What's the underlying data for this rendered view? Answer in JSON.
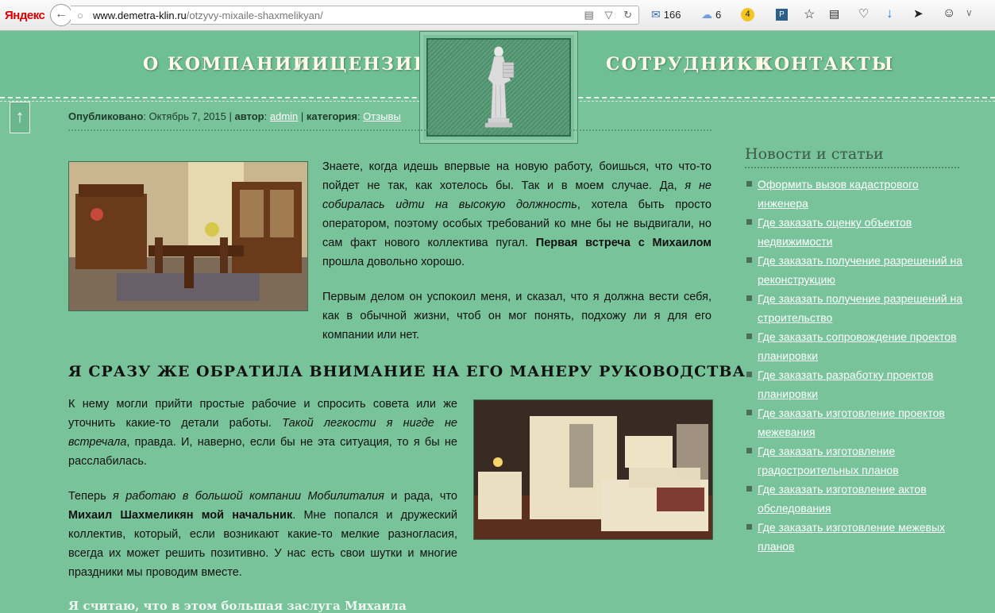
{
  "browser": {
    "logo": "Яндекс",
    "url_domain": "www.demetra-klin.ru",
    "url_path": "/otzyvy-mixaile-shaxmelikyan/",
    "mail_count": "166",
    "weather_count": "6",
    "badge_count": "4"
  },
  "nav": {
    "items": [
      "О КОМПАНИИ",
      "ЛИЦЕНЗИИ",
      "СОТРУДНИКИ",
      "КОНТАКТЫ"
    ]
  },
  "meta": {
    "published_label": "Опубликовано",
    "published_date": ": Октябрь 7, 2015 | ",
    "author_label": "автор",
    "author": "admin",
    "category_label": "категория",
    "category": "Отзывы"
  },
  "article": {
    "p1_a": "Знаете, когда идешь впервые на новую работу, боишься, что что-то пойдет не так, как хотелось бы. Так и в моем случае. Да, ",
    "p1_i": "я не собиралась идти на высокую должность",
    "p1_b": ", хотела быть просто оператором, поэтому особых требований ко мне бы не выдвигали, но сам факт нового коллектива пугал. ",
    "p1_bold": "Первая встреча с Михаилом",
    "p1_c": " прошла довольно хорошо.",
    "p2": "Первым делом он успокоил меня, и сказал, что я должна вести себя, как в обычной жизни, чтоб он мог понять, подхожу ли я для его компании или нет.",
    "heading": "Я сразу же обратила внимание на его манеру руководства.",
    "p3_a": "К нему могли прийти простые рабочие и спросить совета или же уточнить какие-то детали работы. ",
    "p3_i": "Такой легкости я нигде не встречала",
    "p3_b": ", правда. И, наверно, если бы не эта ситуация, то я бы не расслабилась.",
    "p4_a": "Теперь ",
    "p4_i": "я работаю в большой компании Мобилиталия",
    "p4_b": " и рада, что ",
    "p4_bold": "Михаил Шахмеликян мой начальник",
    "p4_c": ". Мне попался и дружеский коллектив, который, если возникают какие-то мелкие разногласия, всегда их может решить позитивно. У нас есть свои шутки и многие праздники мы проводим вместе.",
    "p5_partial": "Я считаю, что в этом большая заслуга Михаила"
  },
  "sidebar": {
    "title": "Новости и статьи",
    "links": [
      "Оформить вызов кадастрового инженера",
      "Где заказать оценку объектов недвижимости",
      "Где заказать получение разрешений на реконструкцию",
      "Где заказать получение разрешений на строительство",
      "Где заказать сопровождение проектов планировки",
      "Где заказать разработку проектов планировки",
      "Где заказать изготовление проектов межевания",
      "Где заказать изготовление градостроительных планов",
      "Где заказать изготовление актов обследования",
      "Где заказать изготовление межевых планов"
    ]
  },
  "icons": {
    "back": "back-arrow-icon",
    "reload": "reload-icon",
    "up": "scroll-up-icon"
  },
  "colors": {
    "page_bg": "#78c39a",
    "link": "#ffffff",
    "nav_text": "#fffbe8"
  }
}
